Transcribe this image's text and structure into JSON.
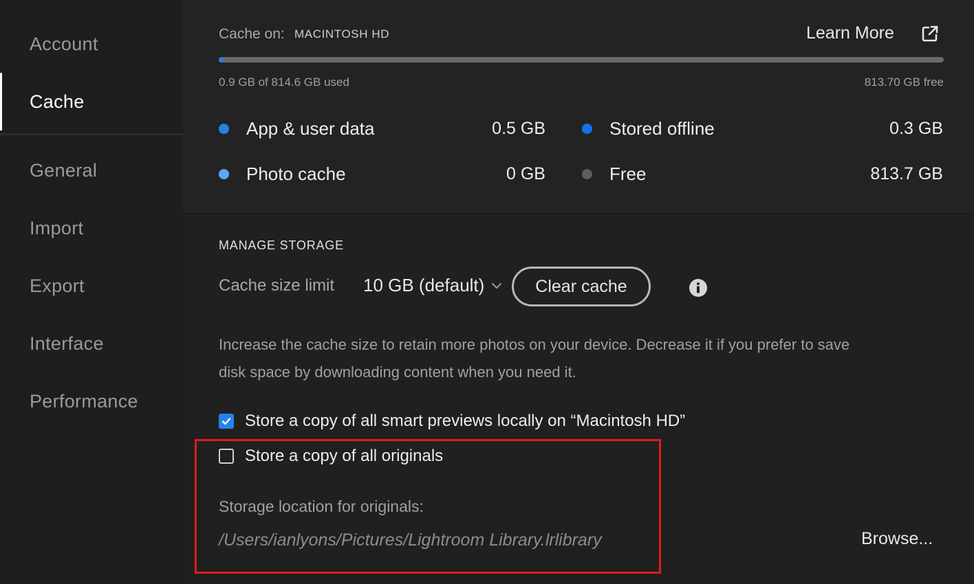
{
  "sidebar": {
    "items": [
      {
        "label": "Account",
        "active": false
      },
      {
        "label": "Cache",
        "active": true
      },
      {
        "label": "General",
        "active": false
      },
      {
        "label": "Import",
        "active": false
      },
      {
        "label": "Export",
        "active": false
      },
      {
        "label": "Interface",
        "active": false
      },
      {
        "label": "Performance",
        "active": false
      }
    ]
  },
  "storage": {
    "cache_on_label": "Cache on:",
    "cache_on_value": "MACINTOSH HD",
    "learn_more": "Learn More",
    "learn_more_icon": "external-link-icon",
    "used_fraction": 0.0011,
    "used_text": "0.9 GB of 814.6 GB used",
    "free_text": "813.70 GB free",
    "legend": [
      {
        "label": "App & user data",
        "value": "0.5 GB",
        "color": "#2680eb"
      },
      {
        "label": "Stored offline",
        "value": "0.3 GB",
        "color": "#1473e6"
      },
      {
        "label": "Photo cache",
        "value": "0 GB",
        "color": "#5aa9f5"
      },
      {
        "label": "Free",
        "value": "813.7 GB",
        "color": "#5e5e5e"
      }
    ]
  },
  "manage": {
    "title": "MANAGE STORAGE",
    "size_label": "Cache size limit",
    "size_value": "10 GB (default)",
    "clear_button": "Clear cache",
    "info_icon": "info-icon",
    "description": "Increase the cache size to retain more photos on your device. Decrease it if you prefer to save disk space by downloading content when you need it.",
    "smart_previews_label": "Store a copy of all smart previews locally on “Macintosh HD”",
    "smart_previews_checked": true,
    "originals_label": "Store a copy of all originals",
    "originals_checked": false,
    "location_label": "Storage location for originals:",
    "location_path": "/Users/ianlyons/Pictures/Lightroom Library.lrlibrary",
    "browse_label": "Browse..."
  },
  "colors": {
    "accent": "#2680eb",
    "highlight_box": "#e01b1b"
  }
}
